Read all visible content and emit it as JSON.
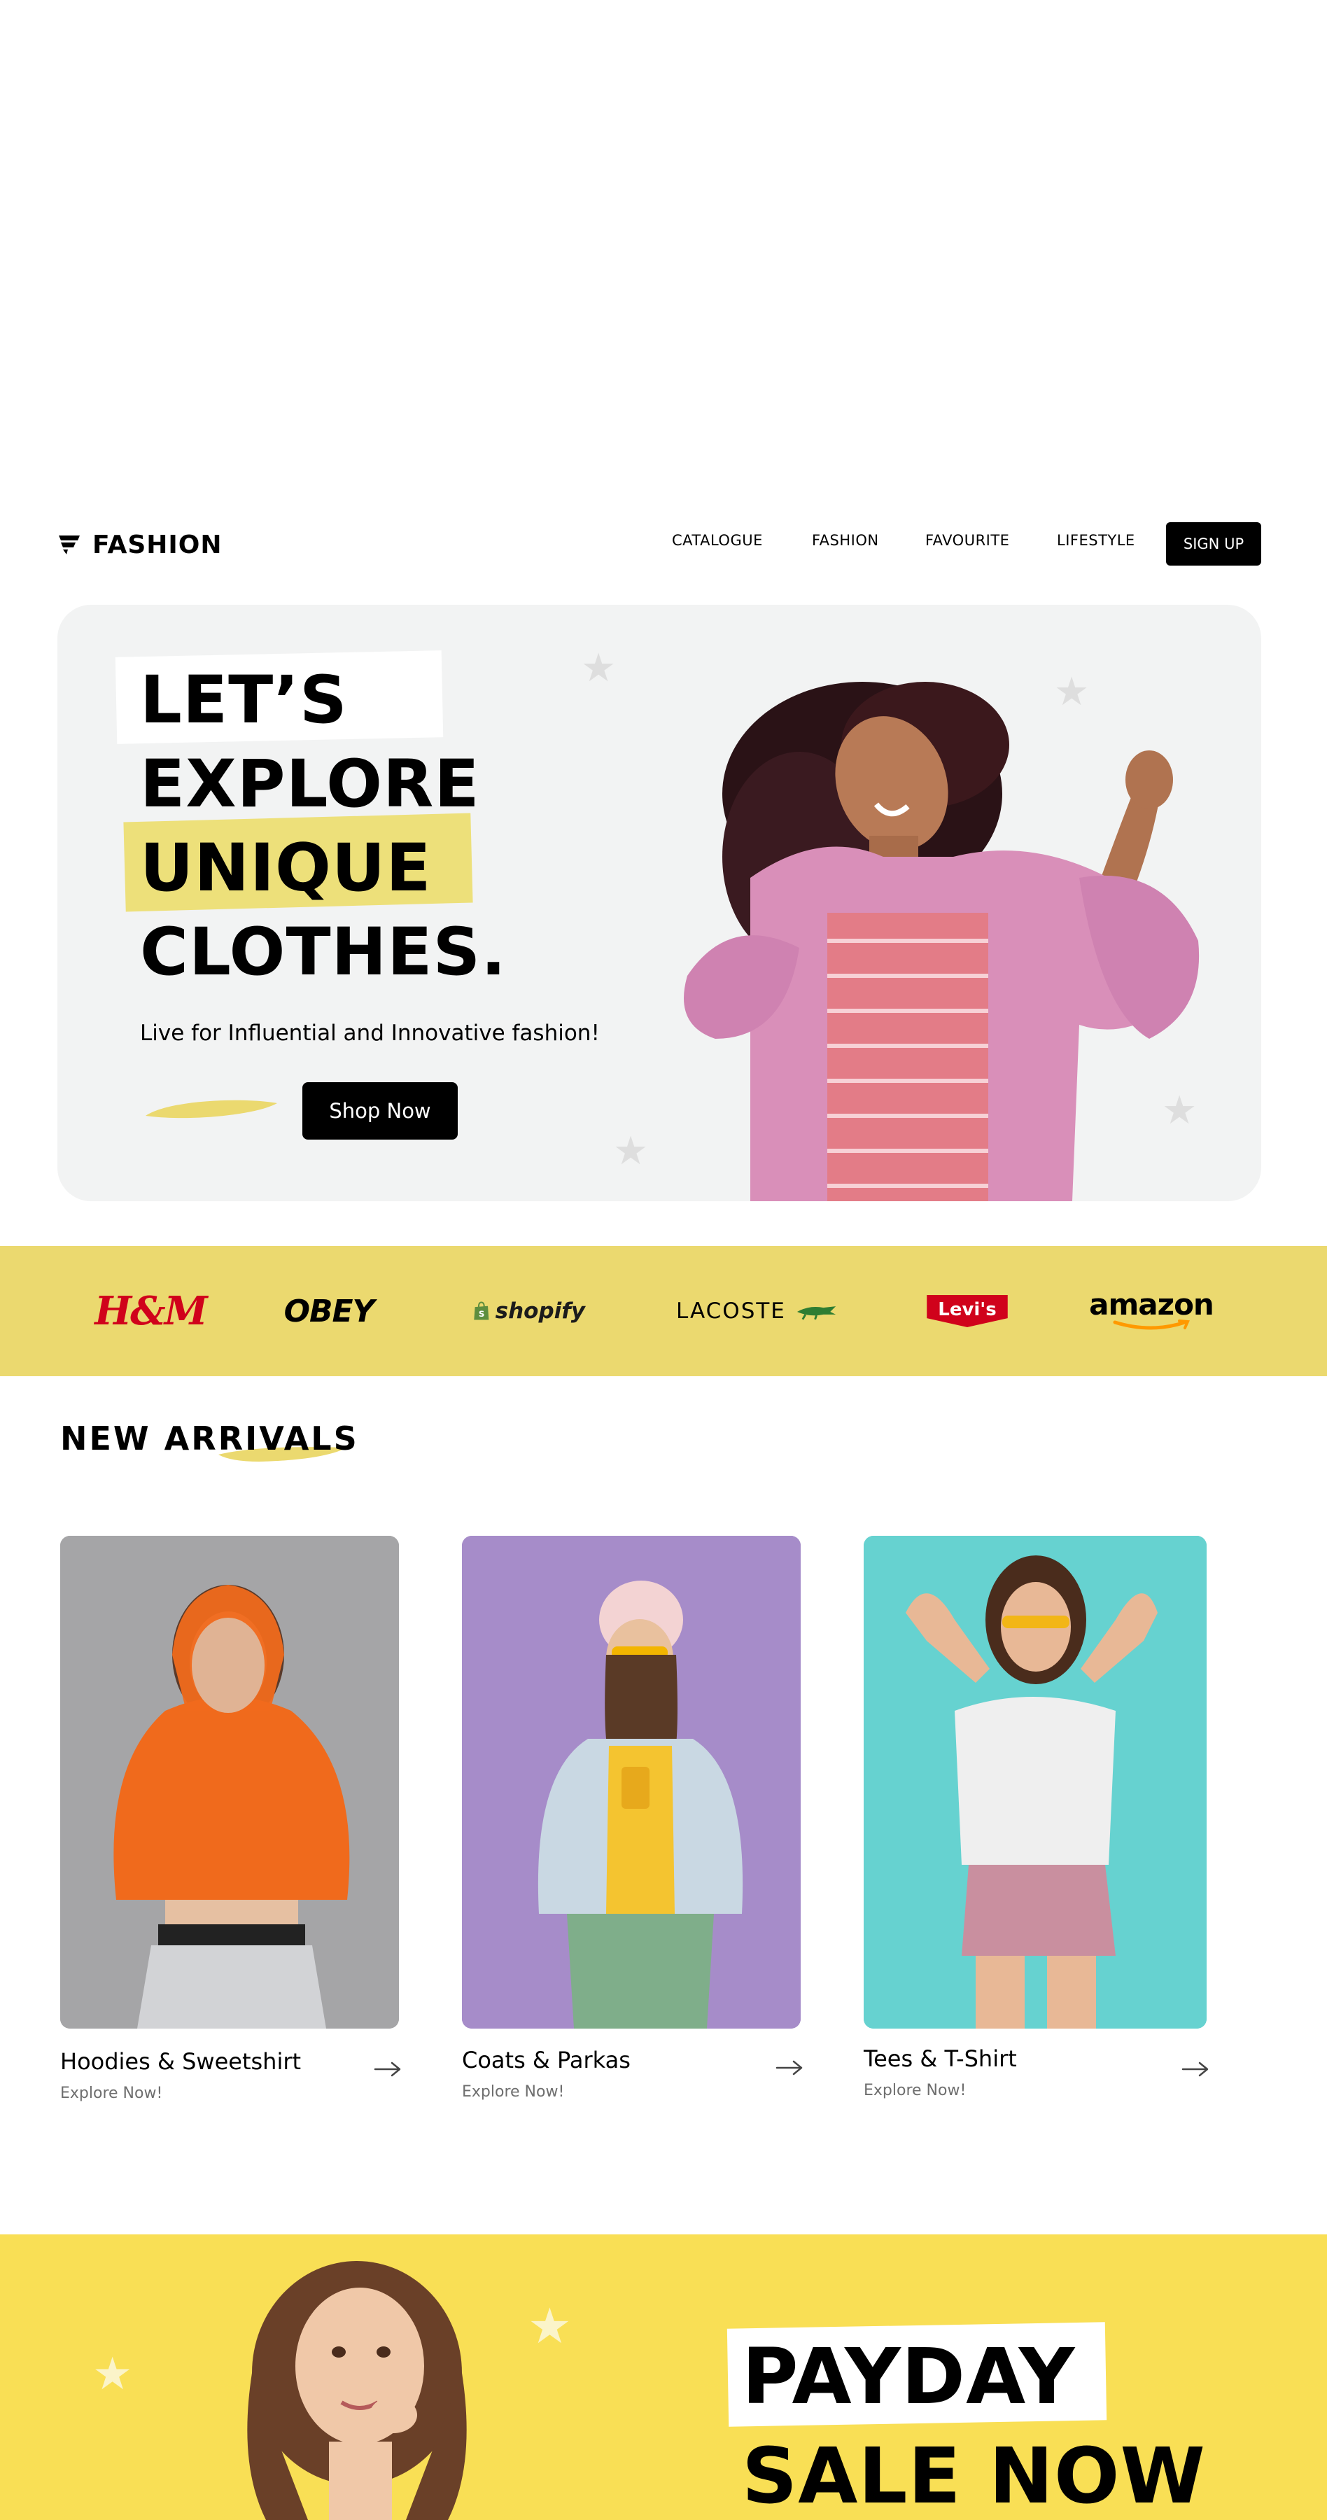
{
  "header": {
    "brand": "FASHION",
    "nav": [
      "CATALOGUE",
      "FASHION",
      "FAVOURITE",
      "LIFESTYLE"
    ],
    "signup_label": "SIGN UP"
  },
  "hero": {
    "headline": [
      "LET’S",
      "EXPLORE",
      "UNIQUE",
      "CLOTHES."
    ],
    "tagline": "Live for Influential and Innovative fashion!",
    "cta_label": "Shop Now"
  },
  "brands": [
    "H&M",
    "OBEY",
    "shopify",
    "LACOSTE",
    "Levi's",
    "amazon"
  ],
  "new_arrivals": {
    "title": "NEW ARRIVALS",
    "items": [
      {
        "title": "Hoodies & Sweetshirt",
        "subtitle": "Explore Now!"
      },
      {
        "title": "Coats & Parkas",
        "subtitle": "Explore Now!"
      },
      {
        "title": "Tees & T-Shirt",
        "subtitle": "Explore Now!"
      }
    ]
  },
  "promo": {
    "line1": "PAYDAY",
    "line2": "SALE NOW"
  },
  "colors": {
    "accent_yellow": "#ebd96f",
    "promo_yellow": "#f9df55",
    "hero_bg": "#f2f3f3",
    "button_black": "#000000"
  }
}
